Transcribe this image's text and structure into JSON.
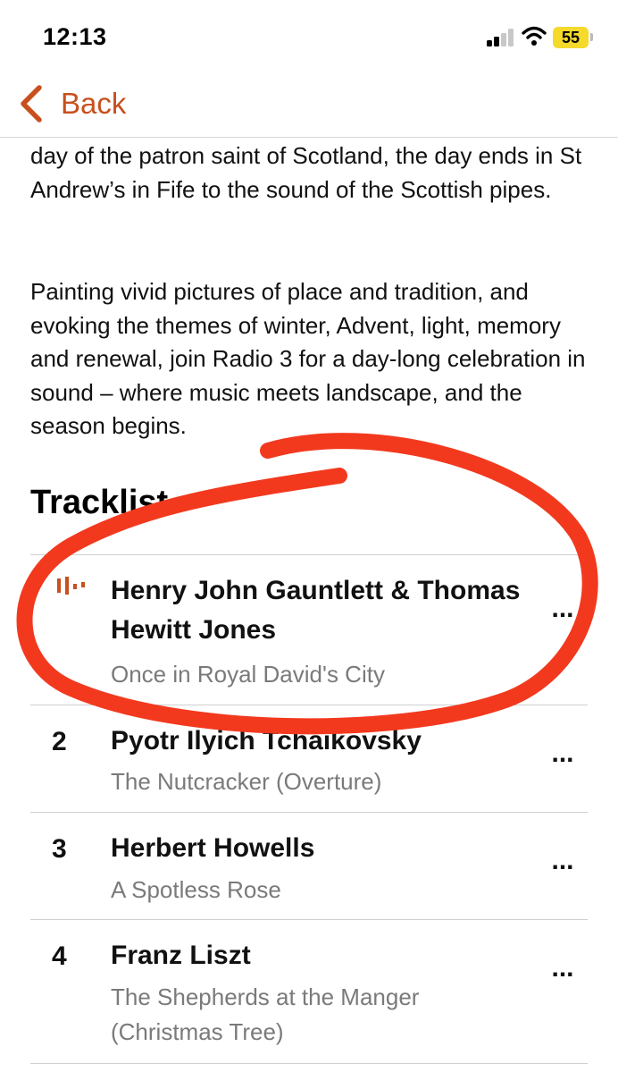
{
  "status_bar": {
    "time": "12:13",
    "battery_level": "55",
    "signal_icon": "signal-bars-icon",
    "wifi_icon": "wifi-icon"
  },
  "nav": {
    "back_label": "Back",
    "back_icon": "chevron-left-icon",
    "accent_color": "#c8501e"
  },
  "description": {
    "paragraph_1": "day of the patron saint of Scotland, the day ends in St Andrew’s in Fife to the sound of the Scottish pipes.",
    "paragraph_2": "Painting vivid pictures of place and tradition, and evoking the themes of winter, Advent, light, memory and renewal, join Radio 3 for a day-long celebration in sound – where music meets landscape, and the season begins."
  },
  "tracklist": {
    "heading": "Tracklist",
    "tracks": [
      {
        "number": "",
        "now_playing": true,
        "artist": "Henry John Gauntlett & Thomas Hewitt Jones",
        "title": "Once in Royal David's City",
        "menu": "..."
      },
      {
        "number": "2",
        "artist": "Pyotr Ilyich Tchaikovsky",
        "title": "The Nutcracker (Overture)",
        "menu": "..."
      },
      {
        "number": "3",
        "artist": "Herbert Howells",
        "title": "A Spotless Rose",
        "menu": "..."
      },
      {
        "number": "4",
        "artist": "Franz Liszt",
        "title": "The Shepherds at the Manger (Christmas Tree)",
        "menu": "..."
      }
    ]
  },
  "annotation": {
    "color": "#f2391e",
    "shape": "hand-drawn circle around now playing track"
  }
}
